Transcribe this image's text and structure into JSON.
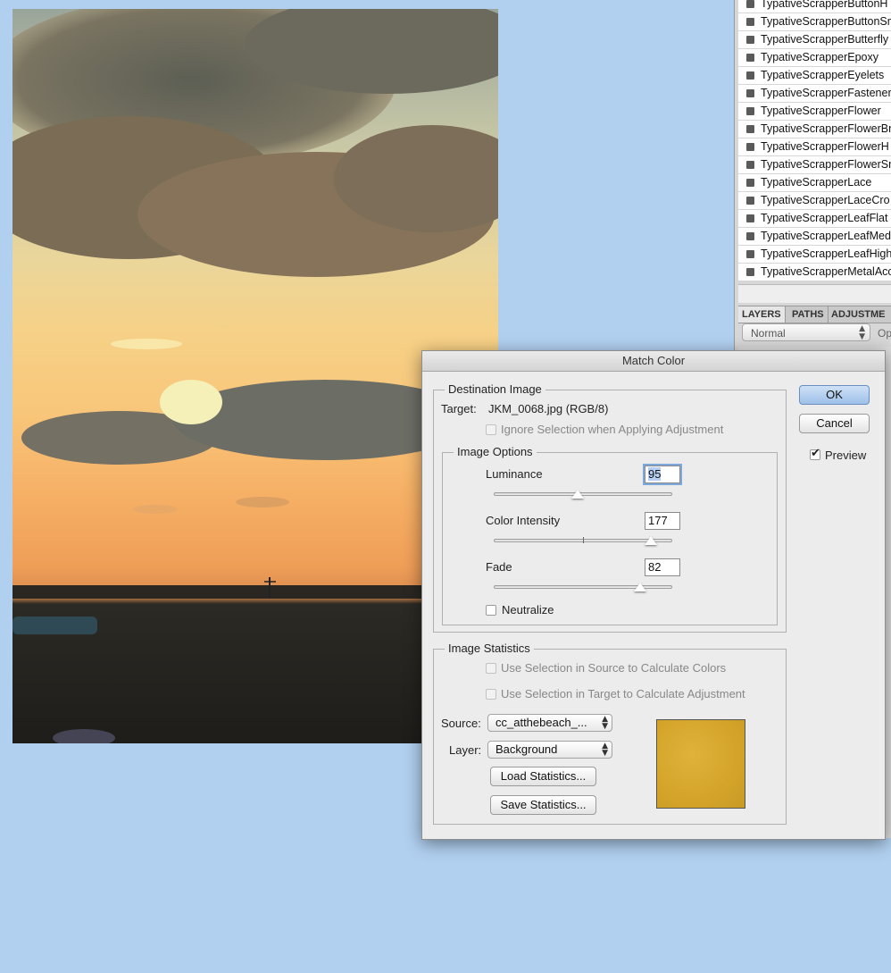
{
  "brushes": {
    "items": [
      "TypativeScrapperButtonH",
      "TypativeScrapperButtonSm",
      "TypativeScrapperButterfly",
      "TypativeScrapperEpoxy",
      "TypativeScrapperEyelets",
      "TypativeScrapperFastener",
      "TypativeScrapperFlower",
      "TypativeScrapperFlowerBr",
      "TypativeScrapperFlowerH",
      "TypativeScrapperFlowerSm",
      "TypativeScrapperLace",
      "TypativeScrapperLaceCro",
      "TypativeScrapperLeafFlat",
      "TypativeScrapperLeafMed",
      "TypativeScrapperLeafHigh",
      "TypativeScrapperMetalAcc"
    ]
  },
  "layers_panel": {
    "tabs": [
      "LAYERS",
      "PATHS",
      "ADJUSTME"
    ],
    "blend_mode": "Normal",
    "opacity_label": "Op"
  },
  "dialog": {
    "title": "Match Color",
    "destination": {
      "legend": "Destination Image",
      "target_label": "Target:",
      "target_value": "JKM_0068.jpg (RGB/8)",
      "ignore_selection": "Ignore Selection when Applying Adjustment"
    },
    "image_options": {
      "legend": "Image Options",
      "luminance_label": "Luminance",
      "luminance_value": "95",
      "luminance_fraction": 0.47,
      "intensity_label": "Color Intensity",
      "intensity_value": "177",
      "intensity_fraction": 0.88,
      "fade_label": "Fade",
      "fade_value": "82",
      "fade_fraction": 0.82,
      "neutralize": "Neutralize"
    },
    "statistics": {
      "legend": "Image Statistics",
      "use_source": "Use Selection in Source to Calculate Colors",
      "use_target": "Use Selection in Target to Calculate Adjustment",
      "source_label": "Source:",
      "source_value": "cc_atthebeach_...",
      "layer_label": "Layer:",
      "layer_value": "Background",
      "load_button": "Load Statistics...",
      "save_button": "Save Statistics...",
      "swatch_color": "#d4a42a"
    },
    "ok_button": "OK",
    "cancel_button": "Cancel",
    "preview_label": "Preview"
  }
}
